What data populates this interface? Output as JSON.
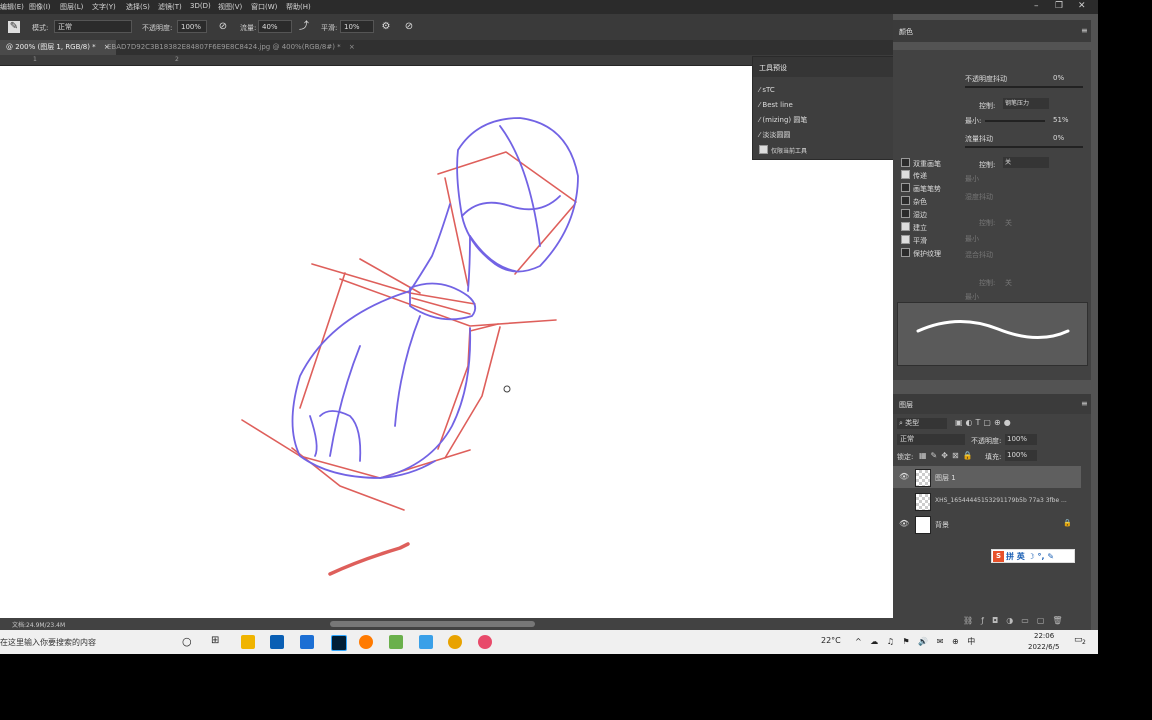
{
  "menubar": {
    "items": [
      "编辑(E)",
      "图像(I)",
      "图层(L)",
      "文字(Y)",
      "选择(S)",
      "滤镜(T)",
      "3D(D)",
      "视图(V)",
      "窗口(W)",
      "帮助(H)"
    ],
    "window_controls": [
      "–",
      "❐",
      "✕"
    ]
  },
  "options": {
    "mode_label": "模式:",
    "mode_value": "正常",
    "opacity_label": "不透明度:",
    "opacity_value": "100%",
    "flow_label": "流量:",
    "flow_value": "40%",
    "smooth_label": "平滑:",
    "smooth_value": "10%"
  },
  "tabs": [
    {
      "label": "@ 200% (图层 1, RGB/8) *",
      "close": "×"
    },
    {
      "label": "EBAD7D92C3B18382E84807F6E9E8C8424.jpg @ 400%(RGB/8#) *",
      "close": "×"
    }
  ],
  "ruler": {
    "mark_1": "1",
    "mark_2": "2"
  },
  "tool_presets": {
    "title": "工具预设",
    "items": [
      "sTC",
      "Best line",
      "(mizing) 圆笔",
      "淡淡圆圆"
    ],
    "current_tool_only": "仅限当前工具"
  },
  "color_panel": {
    "title": "颜色"
  },
  "brush_settings": {
    "opacity_jitter_label": "不透明度抖动",
    "opacity_jitter_value": "0%",
    "control_label": "控制:",
    "control_value": "钢笔压力",
    "min_label": "最小:",
    "min_value": "51%",
    "flow_jitter_label": "流量抖动",
    "flow_jitter_value": "0%",
    "control2_label": "控制:",
    "control2_value": "关",
    "min2_label": "最小",
    "wet_jitter_label": "湿度抖动",
    "control3_label": "控制:",
    "control3_value": "关",
    "min3_label": "最小",
    "mix_jitter_label": "混合抖动",
    "control4_label": "控制:",
    "control4_value": "关",
    "min4_label": "最小",
    "options": [
      {
        "label": "双重画笔",
        "checked": false
      },
      {
        "label": "传递",
        "checked": true
      },
      {
        "label": "画笔笔势",
        "checked": false
      },
      {
        "label": "杂色",
        "checked": false
      },
      {
        "label": "湿边",
        "checked": false
      },
      {
        "label": "建立",
        "checked": true
      },
      {
        "label": "平滑",
        "checked": true
      },
      {
        "label": "保护纹理",
        "checked": false
      }
    ]
  },
  "layers_panel": {
    "title": "图层",
    "filter_label": "类型",
    "blend_mode": "正常",
    "opacity_label": "不透明度:",
    "opacity_value": "100%",
    "lock_label": "锁定:",
    "fill_label": "填充:",
    "fill_value": "100%",
    "layers": [
      {
        "name": "图层 1",
        "visible": true,
        "selected": true
      },
      {
        "name": "XHS_16544445153291179b5b 77a3 3fbe ...",
        "visible": false,
        "selected": false
      },
      {
        "name": "背景",
        "visible": true,
        "selected": false
      }
    ]
  },
  "ime": {
    "label": "拼 英 ☽ °, ✎"
  },
  "status": {
    "doc_info": "文档:24.9M/23.4M"
  },
  "taskbar": {
    "search_placeholder": "在这里输入你要搜索的内容",
    "weather": "22°C",
    "time": "22:06",
    "date": "2022/6/5",
    "notification_count": "2"
  },
  "colors": {
    "red_line": "#d9443f",
    "blue_line": "#5a48e0"
  }
}
